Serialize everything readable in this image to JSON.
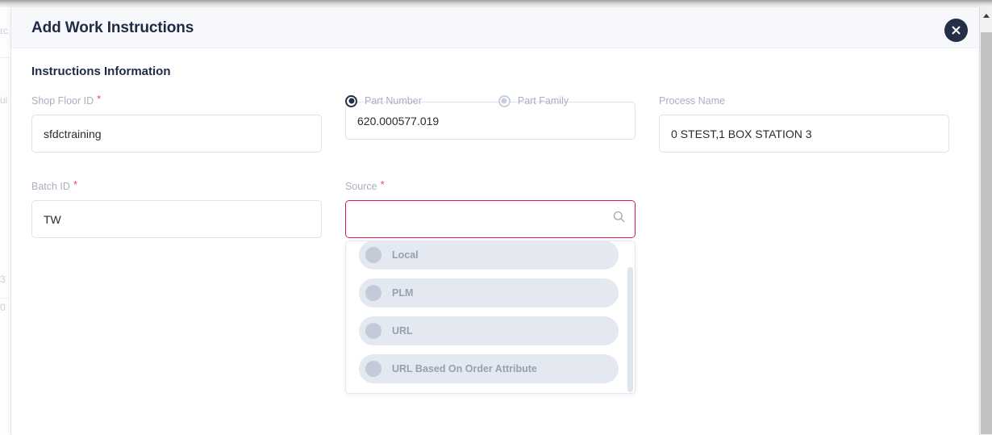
{
  "window": {
    "scrollbar": {
      "up_arrow_icon": "chevron-up-icon"
    }
  },
  "background": {
    "ghost_fragments": [
      "rc",
      "ui",
      "3",
      "0"
    ]
  },
  "modal": {
    "title": "Add Work Instructions",
    "close_label": "×",
    "close_icon": "close-icon",
    "section_title": "Instructions Information",
    "fields": {
      "shop_floor_id": {
        "label": "Shop Floor ID",
        "required": true,
        "value": "sfdctraining",
        "placeholder": ""
      },
      "part_toggle": {
        "options": [
          {
            "label": "Part Number",
            "selected": true
          },
          {
            "label": "Part Family",
            "selected": false
          }
        ],
        "value": "620.000577.019",
        "placeholder": ""
      },
      "process_name": {
        "label": "Process Name",
        "required": false,
        "value": "0 STEST,1 BOX STATION 3",
        "placeholder": ""
      },
      "batch_id": {
        "label": "Batch ID",
        "required": true,
        "value": "TW",
        "placeholder": ""
      },
      "source": {
        "label": "Source",
        "required": true,
        "value": "",
        "placeholder": "",
        "error": true,
        "search_icon": "search-icon"
      }
    },
    "source_dropdown": {
      "options": [
        {
          "label": "Local",
          "icon": "circle-avatar-icon"
        },
        {
          "label": "PLM",
          "icon": "circle-avatar-icon"
        },
        {
          "label": "URL",
          "icon": "circle-avatar-icon"
        },
        {
          "label": "URL Based On Order Attribute",
          "icon": "circle-avatar-icon"
        }
      ]
    }
  },
  "colors": {
    "header_bg": "#f7f8fc",
    "title_text": "#1f2a44",
    "label_text": "#a8b0c0",
    "required_star": "#e8456b",
    "error_border": "#d81e50",
    "input_border": "#dde2ec",
    "accent_dark": "#242f47",
    "dropdown_item_bg": "#e4e8f0",
    "dropdown_item_text": "#97a0b2"
  }
}
